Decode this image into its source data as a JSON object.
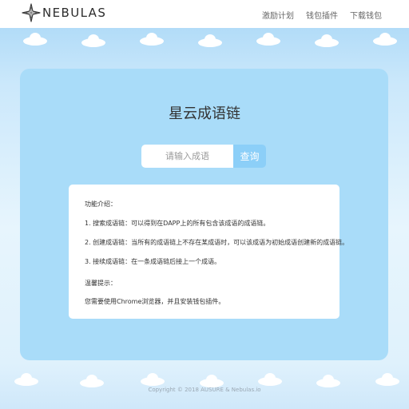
{
  "header": {
    "logo_text": "NEBULAS",
    "nav": [
      "激励计划",
      "钱包插件",
      "下载钱包"
    ]
  },
  "main": {
    "title": "星云成语链",
    "search": {
      "placeholder": "请输入成语",
      "button_label": "查询"
    },
    "info": {
      "heading": "功能介绍：",
      "features": [
        "1. 搜索成语链：可以得到在DAPP上的所有包含该成语的成语链。",
        "2. 创建成语链：当所有的成语链上不存在某成语时，可以该成语为初始成语创建新的成语链。",
        "3. 接续成语链：在一条成语链后接上一个成语。"
      ],
      "tip_heading": "温馨提示：",
      "tip_text": "您需要使用Chrome浏览器，并且安装钱包插件。"
    }
  },
  "footer": {
    "copyright": "Copyright © 2018 AUSURE & Nebulas.io"
  },
  "colors": {
    "card": "#a9dcf9",
    "button": "#8ccff8",
    "sky": "#b2dcf8"
  }
}
